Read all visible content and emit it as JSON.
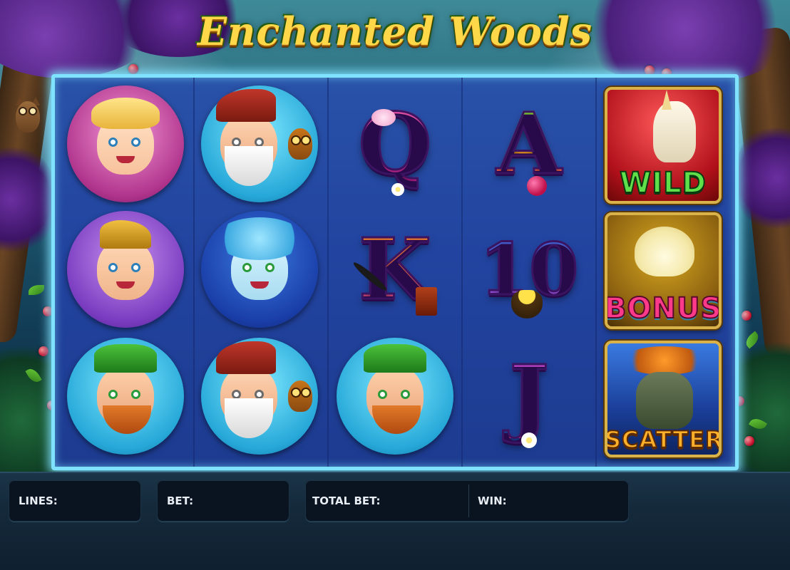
{
  "game": {
    "title": "Enchanted Woods"
  },
  "reels": [
    [
      {
        "symbol": "fairy",
        "icon": "fairy-icon"
      },
      {
        "symbol": "elf",
        "icon": "elf-icon"
      },
      {
        "symbol": "leprechaun",
        "icon": "leprechaun-icon"
      }
    ],
    [
      {
        "symbol": "wizard",
        "icon": "wizard-icon"
      },
      {
        "symbol": "nymph",
        "icon": "nymph-icon"
      },
      {
        "symbol": "wizard",
        "icon": "wizard-icon"
      }
    ],
    [
      {
        "symbol": "Q",
        "icon": "queen-card-icon"
      },
      {
        "symbol": "K",
        "icon": "king-card-icon"
      },
      {
        "symbol": "leprechaun",
        "icon": "leprechaun-icon"
      }
    ],
    [
      {
        "symbol": "A",
        "icon": "ace-card-icon"
      },
      {
        "symbol": "10",
        "icon": "ten-card-icon"
      },
      {
        "symbol": "J",
        "icon": "jack-card-icon"
      }
    ],
    [
      {
        "symbol": "wild",
        "label": "WILD",
        "icon": "unicorn-icon"
      },
      {
        "symbol": "bonus",
        "label": "BONUS",
        "icon": "lotus-icon"
      },
      {
        "symbol": "scatter",
        "label": "SCATTER",
        "icon": "tree-spirit-icon"
      }
    ]
  ],
  "panel": {
    "lines_label": "LINES:",
    "lines_value": "",
    "bet_label": "BET:",
    "bet_value": "",
    "total_bet_label": "TOTAL BET:",
    "total_bet_value": "",
    "win_label": "WIN:",
    "win_value": ""
  },
  "colors": {
    "reel_background": "#2244a0",
    "frame_glow": "#7fe3ff",
    "panel_background": "#14293a",
    "box_background": "#0a1420",
    "title_gold": "#ffd84a"
  }
}
